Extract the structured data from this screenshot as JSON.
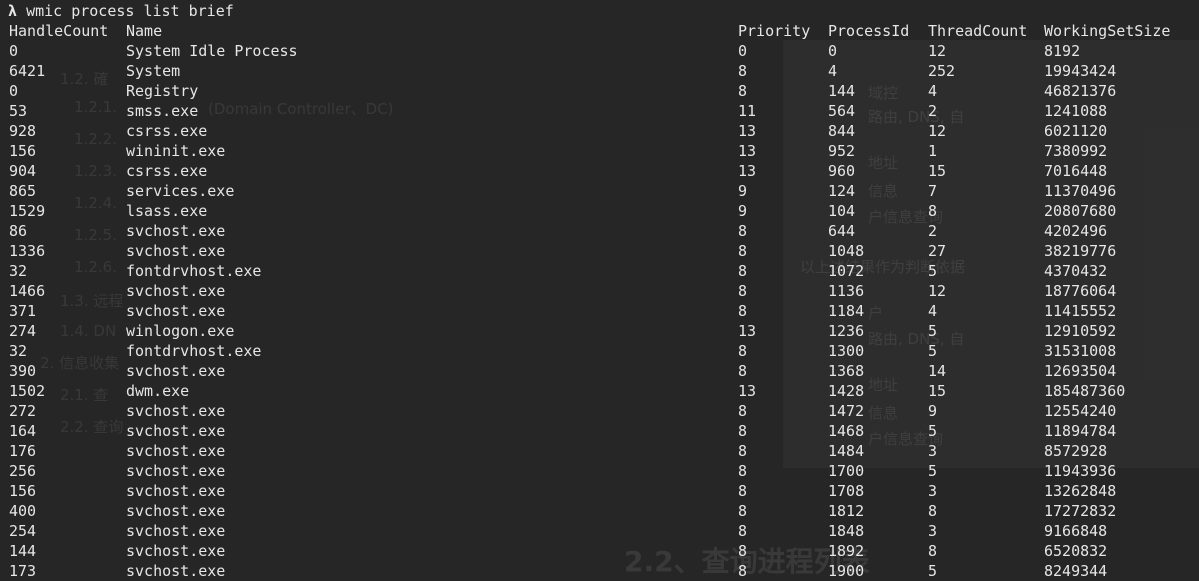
{
  "command": {
    "prompt": "λ",
    "text": "wmic process list brief"
  },
  "headers": {
    "handle_count": "HandleCount",
    "name": "Name",
    "priority": "Priority",
    "process_id": "ProcessId",
    "thread_count": "ThreadCount",
    "working_set_size": "WorkingSetSize"
  },
  "rows": [
    [
      "0",
      "System Idle Process",
      "0",
      "0",
      "12",
      "8192"
    ],
    [
      "6421",
      "System",
      "8",
      "4",
      "252",
      "19943424"
    ],
    [
      "0",
      "Registry",
      "8",
      "144",
      "4",
      "46821376"
    ],
    [
      "53",
      "smss.exe",
      "11",
      "564",
      "2",
      "1241088"
    ],
    [
      "928",
      "csrss.exe",
      "13",
      "844",
      "12",
      "6021120"
    ],
    [
      "156",
      "wininit.exe",
      "13",
      "952",
      "1",
      "7380992"
    ],
    [
      "904",
      "csrss.exe",
      "13",
      "960",
      "15",
      "7016448"
    ],
    [
      "865",
      "services.exe",
      "9",
      "124",
      "7",
      "11370496"
    ],
    [
      "1529",
      "lsass.exe",
      "9",
      "104",
      "8",
      "20807680"
    ],
    [
      "86",
      "svchost.exe",
      "8",
      "644",
      "2",
      "4202496"
    ],
    [
      "1336",
      "svchost.exe",
      "8",
      "1048",
      "27",
      "38219776"
    ],
    [
      "32",
      "fontdrvhost.exe",
      "8",
      "1072",
      "5",
      "4370432"
    ],
    [
      "1466",
      "svchost.exe",
      "8",
      "1136",
      "12",
      "18776064"
    ],
    [
      "371",
      "svchost.exe",
      "8",
      "1184",
      "4",
      "11415552"
    ],
    [
      "274",
      "winlogon.exe",
      "13",
      "1236",
      "5",
      "12910592"
    ],
    [
      "32",
      "fontdrvhost.exe",
      "8",
      "1300",
      "5",
      "31531008"
    ],
    [
      "390",
      "svchost.exe",
      "8",
      "1368",
      "14",
      "12693504"
    ],
    [
      "1502",
      "dwm.exe",
      "13",
      "1428",
      "15",
      "185487360"
    ],
    [
      "272",
      "svchost.exe",
      "8",
      "1472",
      "9",
      "12554240"
    ],
    [
      "164",
      "svchost.exe",
      "8",
      "1468",
      "5",
      "11894784"
    ],
    [
      "176",
      "svchost.exe",
      "8",
      "1484",
      "3",
      "8572928"
    ],
    [
      "256",
      "svchost.exe",
      "8",
      "1700",
      "5",
      "11943936"
    ],
    [
      "156",
      "svchost.exe",
      "8",
      "1708",
      "3",
      "13262848"
    ],
    [
      "400",
      "svchost.exe",
      "8",
      "1812",
      "8",
      "17272832"
    ],
    [
      "254",
      "svchost.exe",
      "8",
      "1848",
      "3",
      "9166848"
    ],
    [
      "144",
      "svchost.exe",
      "8",
      "1892",
      "8",
      "6520832"
    ],
    [
      "173",
      "svchost.exe",
      "8",
      "1900",
      "5",
      "8249344"
    ]
  ],
  "ghost_text": {
    "outline": [
      "1.2. 確",
      "1.2.1.",
      "(Domain Controller、DC)",
      "1.2.2.",
      "1.2.3.",
      "1.2.4.",
      "1.2.5.",
      "1.2.6.",
      "1.3. 远程",
      "1.4. DN",
      "2. 信息收集",
      "2.1. 查",
      "2.2. 查询"
    ],
    "right": [
      "域控",
      "路由, DNS, 自",
      "地址",
      "信息",
      "户信息查询",
      "以上述结果作为判断依据",
      "户",
      "路由, DNS, 自",
      "地址",
      "信息",
      "户信息查询"
    ],
    "heading": "2.2、查询进程列表"
  }
}
